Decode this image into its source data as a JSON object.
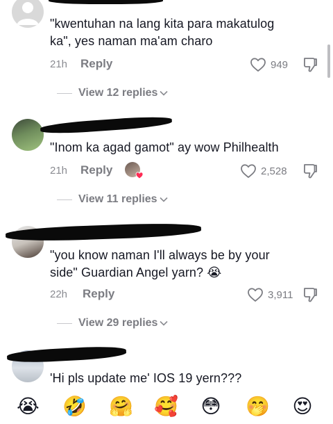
{
  "comments": [
    {
      "text_line1": "\"kwentuhan na lang kita para makatulog",
      "text_line2": "ka\", yes naman ma'am charo",
      "time": "21h",
      "reply_label": "Reply",
      "likes": "949",
      "view_replies": "View 12 replies",
      "creator_liked": false
    },
    {
      "text_line1": "\"Inom ka agad gamot\" ay wow Philhealth",
      "time": "21h",
      "reply_label": "Reply",
      "likes": "2,528",
      "view_replies": "View 11 replies",
      "creator_liked": true
    },
    {
      "text_line1": "\"you know naman I'll always be by your",
      "text_line2": "side\" Guardian Angel yarn? 😭",
      "time": "22h",
      "reply_label": "Reply",
      "likes": "3,911",
      "view_replies": "View 29 replies",
      "creator_liked": false
    },
    {
      "text_line1": "'Hi pls update me' IOS 19 yern???"
    }
  ],
  "emoji_bar": [
    "😭",
    "🤣",
    "🤗",
    "🥰",
    "😳",
    "🤭",
    "😍"
  ],
  "colors": {
    "text": "#161823",
    "muted": "#7b7c82",
    "redaction": "#0a0a0a",
    "heart_badge": "#fe2c55"
  }
}
